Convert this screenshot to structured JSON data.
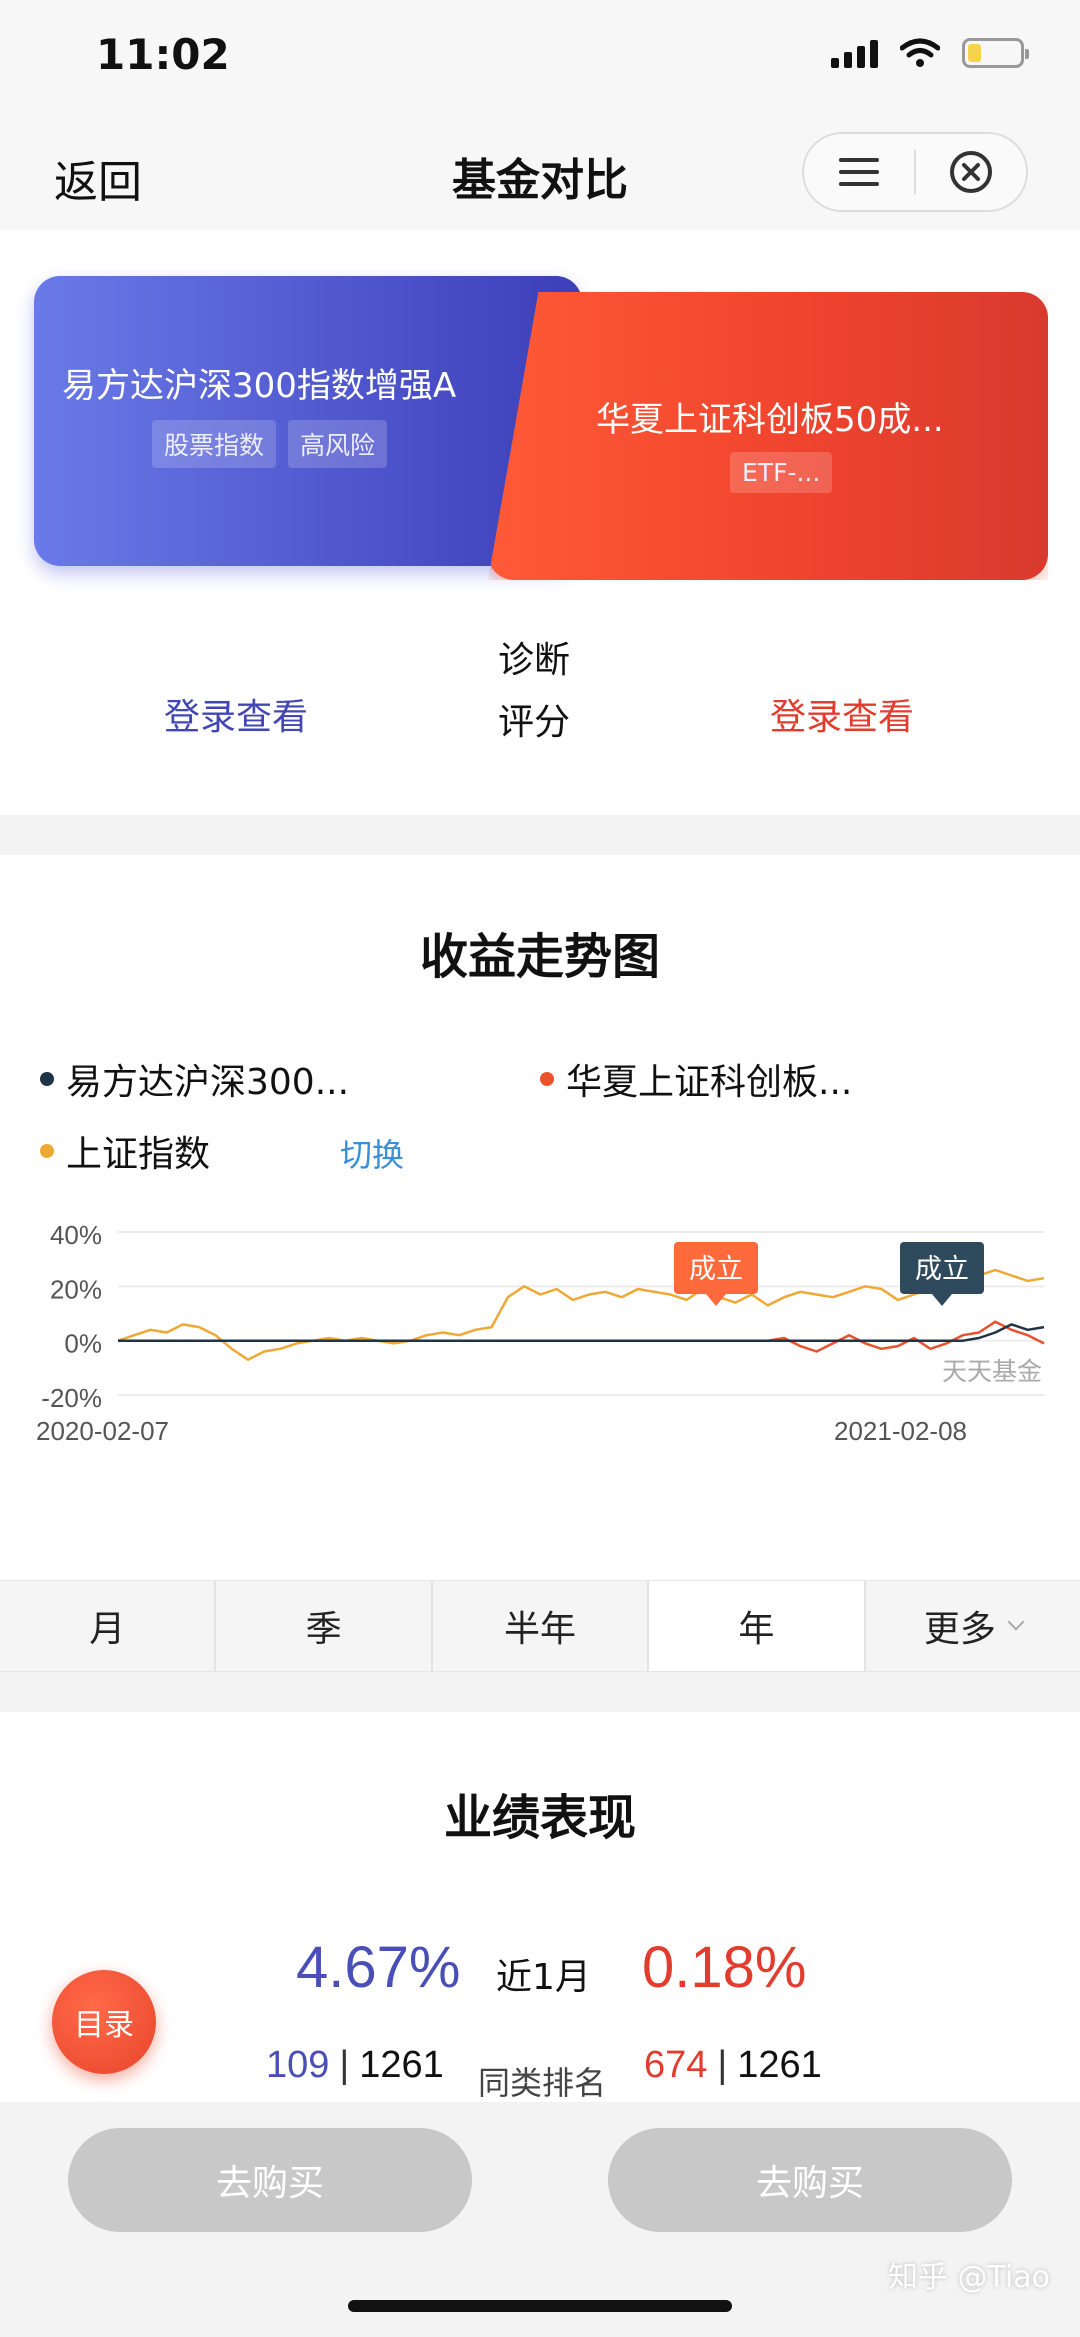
{
  "status_bar": {
    "time": "11:02",
    "battery_level": 0.25
  },
  "nav": {
    "back": "返回",
    "title": "基金对比"
  },
  "fund_a": {
    "name": "易方达沪深300指数增强A",
    "tags": [
      "股票指数",
      "高风险"
    ],
    "color": "#4a4fc7"
  },
  "fund_b": {
    "name": "华夏上证科创板50成...",
    "tags": [
      "ETF-..."
    ],
    "color": "#f0442e"
  },
  "diagnosis": {
    "label_line1": "诊断",
    "label_line2": "评分",
    "left_link": "登录查看",
    "right_link": "登录查看"
  },
  "chart_section": {
    "heading": "收益走势图",
    "legend": [
      {
        "name": "易方达沪深300...",
        "color": "#1f3446"
      },
      {
        "name": "华夏上证科创板...",
        "color": "#e8532e"
      },
      {
        "name": "上证指数",
        "color": "#f0a835"
      }
    ],
    "switch_label": "切换",
    "watermark": "天天基金",
    "establish_label_1": "成立",
    "establish_label_2": "成立"
  },
  "chart_data": {
    "type": "line",
    "x_start_label": "2020-02-07",
    "x_end_label": "2021-02-08",
    "ylim": [
      -20,
      40
    ],
    "y_ticks": [
      "40%",
      "20%",
      "0%",
      "-20%"
    ],
    "grid": true,
    "series": [
      {
        "name": "上证指数",
        "color": "#f0a835",
        "values": [
          0,
          2,
          4,
          3,
          6,
          5,
          2,
          -3,
          -7,
          -4,
          -3,
          -1,
          0,
          1,
          0,
          1,
          0,
          -1,
          0,
          2,
          3,
          2,
          4,
          5,
          16,
          20,
          17,
          19,
          15,
          17,
          18,
          16,
          19,
          18,
          17,
          15,
          19,
          16,
          14,
          17,
          13,
          16,
          18,
          17,
          16,
          18,
          20,
          19,
          15,
          17,
          19,
          22,
          25,
          24,
          26,
          24,
          22,
          23
        ]
      },
      {
        "name": "华夏上证科创板...",
        "color": "#e8532e",
        "values": [
          0,
          0,
          0,
          0,
          0,
          0,
          0,
          0,
          0,
          0,
          0,
          0,
          0,
          0,
          0,
          0,
          0,
          0,
          0,
          0,
          0,
          0,
          0,
          0,
          0,
          0,
          0,
          0,
          0,
          0,
          0,
          0,
          0,
          0,
          0,
          0,
          0,
          0,
          0,
          0,
          0,
          1,
          -2,
          -4,
          -1,
          2,
          -1,
          -3,
          -2,
          1,
          -3,
          -1,
          2,
          3,
          7,
          4,
          2,
          -1
        ]
      },
      {
        "name": "易方达沪深300...",
        "color": "#1f3446",
        "values": [
          0,
          0,
          0,
          0,
          0,
          0,
          0,
          0,
          0,
          0,
          0,
          0,
          0,
          0,
          0,
          0,
          0,
          0,
          0,
          0,
          0,
          0,
          0,
          0,
          0,
          0,
          0,
          0,
          0,
          0,
          0,
          0,
          0,
          0,
          0,
          0,
          0,
          0,
          0,
          0,
          0,
          0,
          0,
          0,
          0,
          0,
          0,
          0,
          0,
          0,
          0,
          0,
          0,
          1,
          3,
          6,
          4,
          5
        ]
      }
    ]
  },
  "period_tabs": {
    "items": [
      "月",
      "季",
      "半年",
      "年",
      "更多"
    ],
    "active_index": 3
  },
  "performance": {
    "heading": "业绩表现",
    "period_label": "近1月",
    "left_return": "4.67%",
    "right_return": "0.18%",
    "rank_label": "同类排名",
    "left_rank": "109",
    "left_total": "1261",
    "right_rank": "674",
    "right_total": "1261",
    "rank_sep": "|"
  },
  "catalog_button": "目录",
  "bottom": {
    "buy_left": "去购买",
    "buy_right": "去购买",
    "watermark": "知乎 @Tiao"
  }
}
